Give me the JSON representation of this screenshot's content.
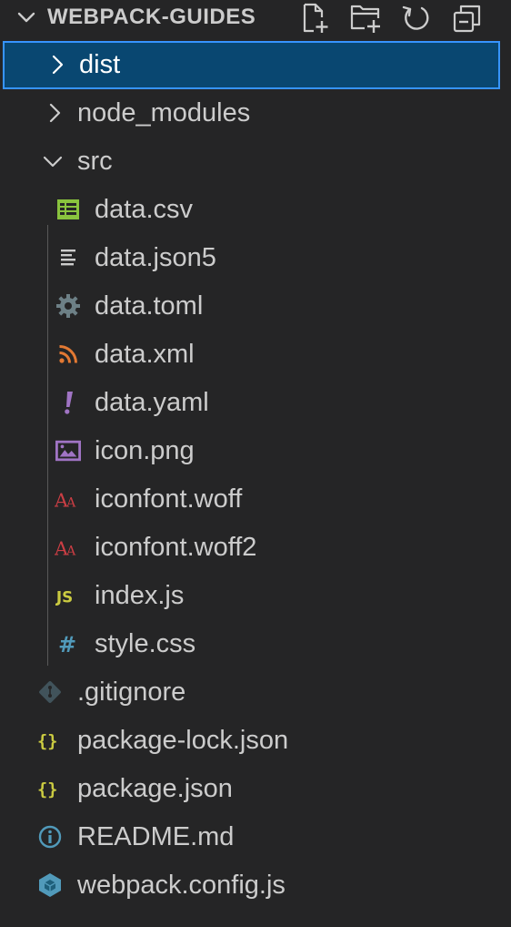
{
  "explorer": {
    "section_title": "WEBPACK-GUIDES",
    "actions": [
      {
        "name": "new-file-button",
        "icon": "new-file-icon",
        "title": "New File"
      },
      {
        "name": "new-folder-button",
        "icon": "new-folder-icon",
        "title": "New Folder"
      },
      {
        "name": "refresh-button",
        "icon": "refresh-icon",
        "title": "Refresh Explorer"
      },
      {
        "name": "collapse-all-button",
        "icon": "collapse-all-icon",
        "title": "Collapse Folders in Explorer"
      }
    ]
  },
  "tree": {
    "items": [
      {
        "label": "dist",
        "type": "folder",
        "expanded": false,
        "selected": true,
        "depth": 0
      },
      {
        "label": "node_modules",
        "type": "folder",
        "expanded": false,
        "selected": false,
        "depth": 0
      },
      {
        "label": "src",
        "type": "folder",
        "expanded": true,
        "selected": false,
        "depth": 0
      },
      {
        "label": "data.csv",
        "type": "file",
        "icon": "csv-icon",
        "depth": 1
      },
      {
        "label": "data.json5",
        "type": "file",
        "icon": "text-lines-icon",
        "depth": 1
      },
      {
        "label": "data.toml",
        "type": "file",
        "icon": "gear-icon",
        "depth": 1
      },
      {
        "label": "data.xml",
        "type": "file",
        "icon": "rss-icon",
        "depth": 1
      },
      {
        "label": "data.yaml",
        "type": "file",
        "icon": "exclamation-icon",
        "depth": 1
      },
      {
        "label": "icon.png",
        "type": "file",
        "icon": "image-icon",
        "depth": 1
      },
      {
        "label": "iconfont.woff",
        "type": "file",
        "icon": "font-icon",
        "depth": 1
      },
      {
        "label": "iconfont.woff2",
        "type": "file",
        "icon": "font-icon",
        "depth": 1
      },
      {
        "label": "index.js",
        "type": "file",
        "icon": "javascript-icon",
        "depth": 1
      },
      {
        "label": "style.css",
        "type": "file",
        "icon": "hash-icon",
        "depth": 1
      },
      {
        "label": ".gitignore",
        "type": "file",
        "icon": "git-icon",
        "depth": 0
      },
      {
        "label": "package-lock.json",
        "type": "file",
        "icon": "json-braces-icon",
        "depth": 0
      },
      {
        "label": "package.json",
        "type": "file",
        "icon": "json-braces-icon",
        "depth": 0
      },
      {
        "label": "README.md",
        "type": "file",
        "icon": "info-icon",
        "depth": 0
      },
      {
        "label": "webpack.config.js",
        "type": "file",
        "icon": "webpack-cube-icon",
        "depth": 0
      }
    ]
  },
  "colors": {
    "background": "#252526",
    "selection": "#094771",
    "focus_border": "#3794ff",
    "text": "#cccccc",
    "csv": "#89c33e",
    "rss": "#e37933",
    "yaml": "#a074c4",
    "image": "#a074c4",
    "font": "#cc3e44",
    "javascript": "#cbcb41",
    "css": "#519aba",
    "git": "#41535b",
    "json": "#cbcb41",
    "info": "#519aba",
    "webpack": "#519aba"
  }
}
